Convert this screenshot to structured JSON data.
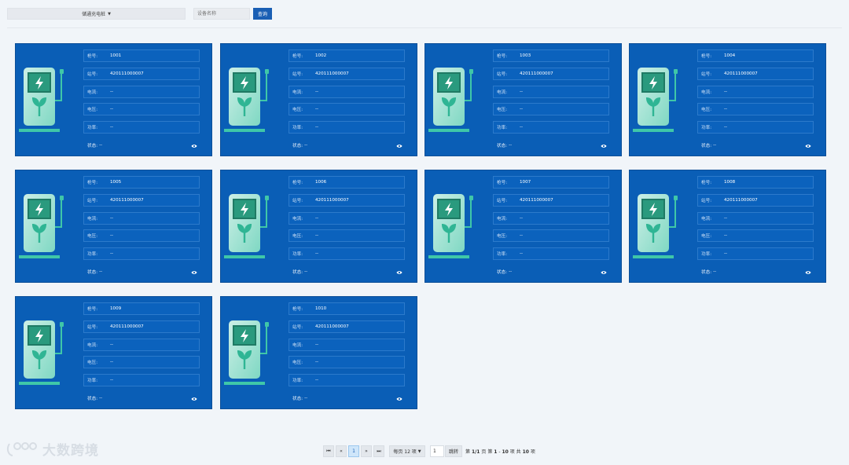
{
  "toolbar": {
    "group_select": "储通充电桩",
    "search_placeholder": "设备名称",
    "query_label": "查询"
  },
  "labels": {
    "gun": "枪号:",
    "station": "站号:",
    "current": "电流:",
    "voltage": "电压:",
    "power": "功率:",
    "status": "状态:"
  },
  "cards": [
    {
      "gun": "1001",
      "station": "420111000007",
      "current": "--",
      "voltage": "--",
      "power": "--",
      "status": "--"
    },
    {
      "gun": "1002",
      "station": "420111000007",
      "current": "--",
      "voltage": "--",
      "power": "--",
      "status": "--"
    },
    {
      "gun": "1003",
      "station": "420111000007",
      "current": "--",
      "voltage": "--",
      "power": "--",
      "status": "--"
    },
    {
      "gun": "1004",
      "station": "420111000007",
      "current": "--",
      "voltage": "--",
      "power": "--",
      "status": "--"
    },
    {
      "gun": "1005",
      "station": "420111000007",
      "current": "--",
      "voltage": "--",
      "power": "--",
      "status": "--"
    },
    {
      "gun": "1006",
      "station": "420111000007",
      "current": "--",
      "voltage": "--",
      "power": "--",
      "status": "--"
    },
    {
      "gun": "1007",
      "station": "420111000007",
      "current": "--",
      "voltage": "--",
      "power": "--",
      "status": "--"
    },
    {
      "gun": "1008",
      "station": "420111000007",
      "current": "--",
      "voltage": "--",
      "power": "--",
      "status": "--"
    },
    {
      "gun": "1009",
      "station": "420111000007",
      "current": "--",
      "voltage": "--",
      "power": "--",
      "status": "--"
    },
    {
      "gun": "1010",
      "station": "420111000007",
      "current": "--",
      "voltage": "--",
      "power": "--",
      "status": "--"
    }
  ],
  "pagination": {
    "first": "⏮",
    "prev": "«",
    "current_page": "1",
    "next": "»",
    "last": "⏭",
    "page_size": "每页 12 项",
    "jump_value": "1",
    "jump_label": "跳转",
    "page_info_prefix": "第",
    "page_info_pages": "1/1",
    "page_info_mid": "页 第",
    "range_start": "1",
    "range_sep": "-",
    "range_end": "10",
    "range_unit": "项 共",
    "total": "10",
    "total_unit": "项"
  },
  "watermark": {
    "text": "大数跨境"
  },
  "colors": {
    "card_bg": "#0a5eb6",
    "accent": "#1a5fb4",
    "pile_green": "#3fc7a8",
    "page_bg": "#f1f5f9"
  },
  "icons": {
    "pile": "charging-pile-icon",
    "eye": "eye-icon",
    "caret": "caret-down-icon"
  }
}
